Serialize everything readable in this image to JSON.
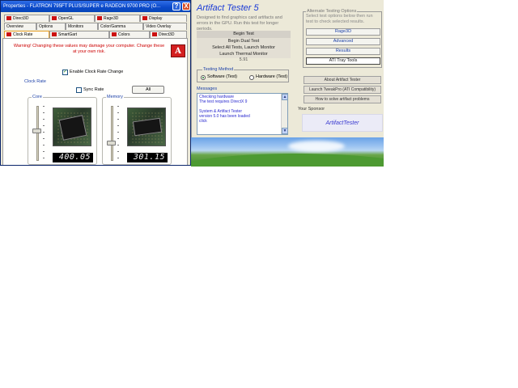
{
  "properties_window": {
    "title": "Properties - FLATRON 795FT PLUS/SUPER e RADEON 9700 PRO (O...",
    "help_label": "?",
    "close_label": "X",
    "tabs_row1": [
      "Direct3D",
      "OpenGL",
      "Rage3D",
      "Display"
    ],
    "tabs_row2": [
      "Overview",
      "Options",
      "Monitors",
      "Color/Gamma",
      "Video Overlay"
    ],
    "tabs_row3": [
      "Clock Rate",
      "SmartGart",
      "Colors",
      "Direct3D"
    ],
    "active_tab": "Clock Rate",
    "warning": "Warning! Changing these values may damage your computer. Change these at your own risk.",
    "logo_letter": "A",
    "enable_clock_label": "Enable Clock Rate Change",
    "enable_clock_checked": "✓",
    "clock_group_label": "Clock Rate",
    "sync_label": "Sync Rate",
    "all_button": "All",
    "core": {
      "label": "Core",
      "value": "400.05",
      "level": 0.55
    },
    "memory": {
      "label": "Memory",
      "value": "301.15",
      "level": 0.3
    }
  },
  "artifact_tester": {
    "title": "Artifact Tester 5",
    "description": "Designed to find graphics card artifacts and errors in the GPU. Run this test for longer periods.",
    "begin_test": "Begin Test",
    "begin_dual": "Begin Dual Test",
    "select_all": "Select All Tests, Launch Monitor",
    "launch_monitor": "Launch Thermal Monitor",
    "monitor_value": "5.91",
    "method_label": "Testing Method",
    "method_options": [
      "Software (Test)",
      "Hardware (Test)"
    ],
    "method_selected": 0,
    "messages_label": "Messages",
    "messages": "Checking hardware\nThe test requires DirectX 9\n\nSystem & Artifact Tester\nversion 5.0 has been loaded\nclick",
    "scroll_up": "▲",
    "scroll_down": "▼",
    "options_label": "Alternate Testing Options",
    "options_desc": "Select test options below then run test to check selected results.",
    "options": [
      "Rage3D",
      "Advanced",
      "Results",
      "ATI Tray Tools"
    ],
    "about_button": "About Artifact Tester",
    "launch_button": "Launch TweakPro (ATI Compatibility)",
    "howto_button": "How to solve artifact problems",
    "sponsor_label": "Your Sponsor",
    "sponsor_text": "ArtifactTester"
  },
  "colors": {
    "titlebar_blue": "#0a48c8",
    "warning_red": "#cc0000",
    "accent_blue": "#1a3ad6"
  }
}
